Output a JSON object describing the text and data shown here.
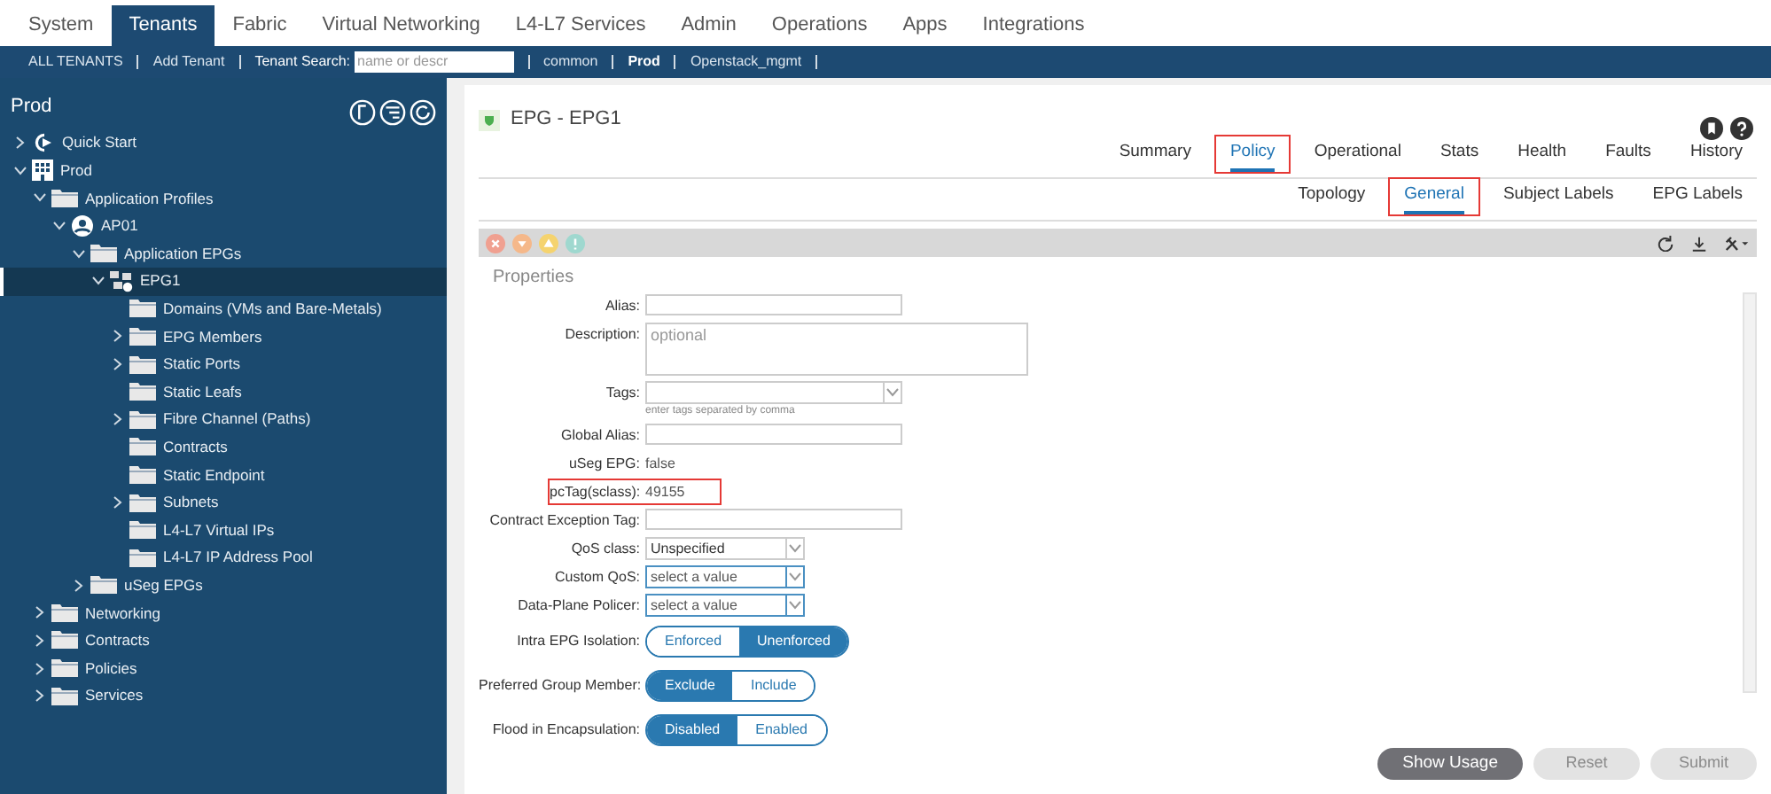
{
  "top_tabs": [
    {
      "label": "System",
      "selected": false
    },
    {
      "label": "Tenants",
      "selected": true
    },
    {
      "label": "Fabric",
      "selected": false
    },
    {
      "label": "Virtual Networking",
      "selected": false
    },
    {
      "label": "L4-L7 Services",
      "selected": false
    },
    {
      "label": "Admin",
      "selected": false
    },
    {
      "label": "Operations",
      "selected": false
    },
    {
      "label": "Apps",
      "selected": false
    },
    {
      "label": "Integrations",
      "selected": false
    }
  ],
  "tenant_bar": [
    {
      "kind": "link",
      "label": "ALL TENANTS",
      "selected": false
    },
    {
      "kind": "link",
      "label": "Add Tenant",
      "selected": false
    },
    {
      "kind": "search",
      "label": "Tenant Search:",
      "placeholder": "name or descr"
    },
    {
      "kind": "link",
      "label": "common",
      "selected": false
    },
    {
      "kind": "link",
      "label": "Prod",
      "selected": true
    },
    {
      "kind": "link",
      "label": "Openstack_mgmt",
      "selected": false
    }
  ],
  "sidebar": {
    "title": "Prod",
    "tree": [
      {
        "label": "Quick Start",
        "kind": "quickstart",
        "expanded": false,
        "selected": false
      },
      {
        "label": "Prod",
        "kind": "tenant",
        "expanded": true,
        "selected": false,
        "children": [
          {
            "label": "Application Profiles",
            "kind": "folder",
            "expanded": true,
            "selected": false,
            "children": [
              {
                "label": "AP01",
                "kind": "app",
                "expanded": true,
                "selected": false,
                "children": [
                  {
                    "label": "Application EPGs",
                    "kind": "folder",
                    "expanded": true,
                    "selected": false,
                    "children": [
                      {
                        "label": "EPG1",
                        "kind": "epg",
                        "expanded": true,
                        "selected": true,
                        "children": [
                          {
                            "label": "Domains (VMs and Bare-Metals)",
                            "kind": "folder",
                            "selected": false
                          },
                          {
                            "label": "EPG Members",
                            "kind": "folder",
                            "expanded": false,
                            "selected": false
                          },
                          {
                            "label": "Static Ports",
                            "kind": "folder",
                            "expanded": false,
                            "selected": false
                          },
                          {
                            "label": "Static Leafs",
                            "kind": "folder",
                            "selected": false
                          },
                          {
                            "label": "Fibre Channel (Paths)",
                            "kind": "folder",
                            "expanded": false,
                            "selected": false
                          },
                          {
                            "label": "Contracts",
                            "kind": "folder",
                            "selected": false
                          },
                          {
                            "label": "Static Endpoint",
                            "kind": "folder",
                            "selected": false
                          },
                          {
                            "label": "Subnets",
                            "kind": "folder",
                            "expanded": false,
                            "selected": false
                          },
                          {
                            "label": "L4-L7 Virtual IPs",
                            "kind": "folder",
                            "selected": false
                          },
                          {
                            "label": "L4-L7 IP Address Pool",
                            "kind": "folder",
                            "selected": false
                          }
                        ]
                      }
                    ]
                  },
                  {
                    "label": "uSeg EPGs",
                    "kind": "folder",
                    "expanded": false,
                    "selected": false
                  }
                ]
              }
            ]
          },
          {
            "label": "Networking",
            "kind": "folder",
            "expanded": false,
            "selected": false
          },
          {
            "label": "Contracts",
            "kind": "folder",
            "expanded": false,
            "selected": false
          },
          {
            "label": "Policies",
            "kind": "folder",
            "expanded": false,
            "selected": false
          },
          {
            "label": "Services",
            "kind": "folder",
            "expanded": false,
            "selected": false
          }
        ]
      }
    ]
  },
  "content": {
    "title": "EPG - EPG1",
    "tabs": [
      {
        "label": "Summary",
        "selected": false,
        "highlighted": false
      },
      {
        "label": "Policy",
        "selected": true,
        "highlighted": true
      },
      {
        "label": "Operational",
        "selected": false,
        "highlighted": false
      },
      {
        "label": "Stats",
        "selected": false,
        "highlighted": false
      },
      {
        "label": "Health",
        "selected": false,
        "highlighted": false
      },
      {
        "label": "Faults",
        "selected": false,
        "highlighted": false
      },
      {
        "label": "History",
        "selected": false,
        "highlighted": false
      }
    ],
    "subtabs": [
      {
        "label": "Topology",
        "selected": false,
        "highlighted": false
      },
      {
        "label": "General",
        "selected": true,
        "highlighted": true
      },
      {
        "label": "Subject Labels",
        "selected": false,
        "highlighted": false
      },
      {
        "label": "EPG Labels",
        "selected": false,
        "highlighted": false
      }
    ],
    "section": "Properties",
    "fields": [
      {
        "kind": "text",
        "label": "Alias:",
        "highlighted": false
      },
      {
        "kind": "textarea",
        "label": "Description:",
        "placeholder": "optional",
        "highlighted": false
      },
      {
        "kind": "combo",
        "label": "Tags:",
        "hint": "enter tags separated by comma",
        "highlighted": false
      },
      {
        "kind": "text",
        "label": "Global Alias:",
        "highlighted": false
      },
      {
        "kind": "readonly",
        "label": "uSeg EPG:",
        "value": "false",
        "highlighted": false
      },
      {
        "kind": "readonly",
        "label": "pcTag(sclass):",
        "value": "49155",
        "highlighted": true
      },
      {
        "kind": "text",
        "label": "Contract Exception Tag:",
        "highlighted": false
      },
      {
        "kind": "select",
        "label": "QoS class:",
        "value": "Unspecified",
        "highlighted": false
      },
      {
        "kind": "select",
        "label": "Custom QoS:",
        "placeholder": "select a value",
        "highlighted": false
      },
      {
        "kind": "select",
        "label": "Data-Plane Policer:",
        "placeholder": "select a value",
        "highlighted": false
      },
      {
        "kind": "toggle",
        "label": "Intra EPG Isolation:",
        "highlighted": false,
        "options": [
          {
            "label": "Enforced",
            "selected": false
          },
          {
            "label": "Unenforced",
            "selected": true
          }
        ]
      },
      {
        "kind": "toggle",
        "label": "Preferred Group Member:",
        "highlighted": false,
        "options": [
          {
            "label": "Exclude",
            "selected": true
          },
          {
            "label": "Include",
            "selected": false
          }
        ]
      },
      {
        "kind": "toggle",
        "label": "Flood in Encapsulation:",
        "highlighted": false,
        "options": [
          {
            "label": "Disabled",
            "selected": true
          },
          {
            "label": "Enabled",
            "selected": false
          }
        ]
      }
    ],
    "buttons": [
      {
        "label": "Show Usage",
        "disabled": false
      },
      {
        "label": "Reset",
        "disabled": true
      },
      {
        "label": "Submit",
        "disabled": true
      }
    ]
  }
}
